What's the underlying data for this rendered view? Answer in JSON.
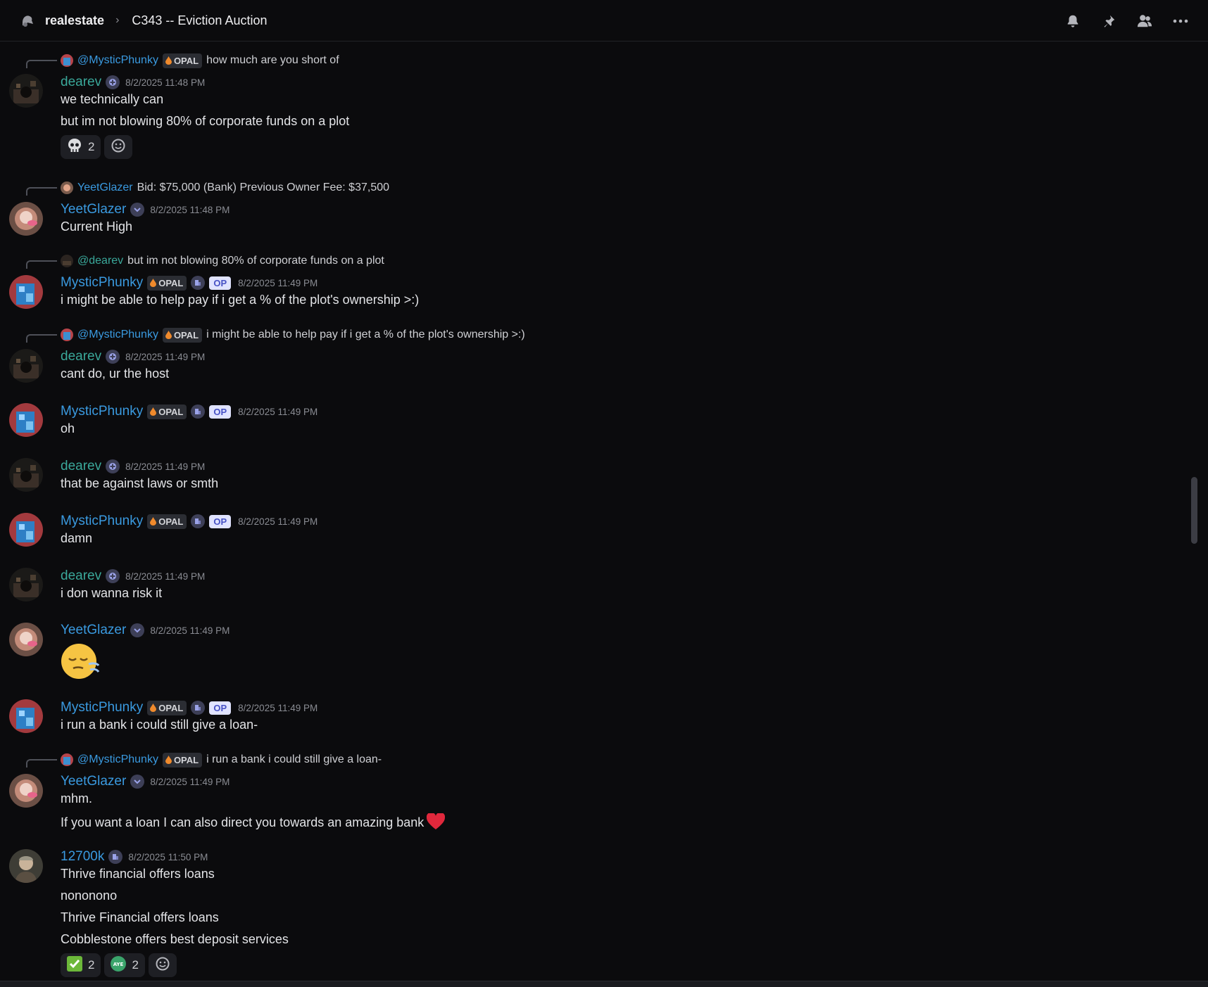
{
  "header": {
    "server": "realestate",
    "separator": "›",
    "thread": "C343 -- Eviction Auction"
  },
  "colors": {
    "background": "#0b0b0d",
    "dearev": "#3aa89a",
    "blue_name": "#3a9ae0",
    "op_badge": "#e0e3ff"
  },
  "header_icons": [
    "bell-icon",
    "pin-icon",
    "members-icon",
    "more-icon"
  ],
  "messages": [
    {
      "reply": {
        "name": "@MysticPhunky",
        "tag": "OPAL",
        "text": "how much are you short of"
      },
      "author": "dearev",
      "time": "8/2/2025 11:48 PM",
      "lines": [
        "we technically can",
        "but im not blowing 80% of corporate funds on a plot"
      ],
      "reactions": [
        {
          "emoji": "skull",
          "count": "2"
        }
      ]
    },
    {
      "reply": {
        "name": "YeetGlazer",
        "text": "Bid: $75,000 (Bank) Previous Owner Fee: $37,500"
      },
      "author": "YeetGlazer",
      "time": "8/2/2025 11:48 PM",
      "lines": [
        "Current High"
      ]
    },
    {
      "reply": {
        "name": "@dearev",
        "text": "but im not blowing 80% of corporate funds on a plot"
      },
      "author": "MysticPhunky",
      "tag": "OPAL",
      "op": "OP",
      "time": "8/2/2025 11:49 PM",
      "lines": [
        "i might be able to help pay if i get a % of the plot's ownership >:)"
      ]
    },
    {
      "reply": {
        "name": "@MysticPhunky",
        "tag": "OPAL",
        "text": "i might be able to help pay if i get a % of the plot's ownership >:)"
      },
      "author": "dearev",
      "time": "8/2/2025 11:49 PM",
      "lines": [
        "cant do, ur the host"
      ]
    },
    {
      "author": "MysticPhunky",
      "tag": "OPAL",
      "op": "OP",
      "time": "8/2/2025 11:49 PM",
      "lines": [
        "oh"
      ]
    },
    {
      "author": "dearev",
      "time": "8/2/2025 11:49 PM",
      "lines": [
        "that be against laws or smth"
      ]
    },
    {
      "author": "MysticPhunky",
      "tag": "OPAL",
      "op": "OP",
      "time": "8/2/2025 11:49 PM",
      "lines": [
        "damn"
      ]
    },
    {
      "author": "dearev",
      "time": "8/2/2025 11:49 PM",
      "lines": [
        "i don wanna risk it"
      ]
    },
    {
      "author": "YeetGlazer",
      "time": "8/2/2025 11:49 PM",
      "emoji": "face-exhaling"
    },
    {
      "author": "MysticPhunky",
      "tag": "OPAL",
      "op": "OP",
      "time": "8/2/2025 11:49 PM",
      "lines": [
        "i run a bank i could still give a loan-"
      ]
    },
    {
      "reply": {
        "name": "@MysticPhunky",
        "tag": "OPAL",
        "text": "i run a bank i could still give a loan-"
      },
      "author": "YeetGlazer",
      "time": "8/2/2025 11:49 PM",
      "lines": [
        "mhm.",
        "If you want a loan I can also direct you towards an amazing bank"
      ]
    },
    {
      "author": "12700k",
      "time": "8/2/2025 11:50 PM",
      "lines": [
        "Thrive financial offers loans",
        "nononono",
        "Thrive Financial offers loans",
        "Cobblestone offers best deposit services"
      ],
      "reactions": [
        {
          "emoji": "check-mark",
          "count": "2"
        },
        {
          "emoji": "aye",
          "count": "2"
        }
      ]
    }
  ]
}
